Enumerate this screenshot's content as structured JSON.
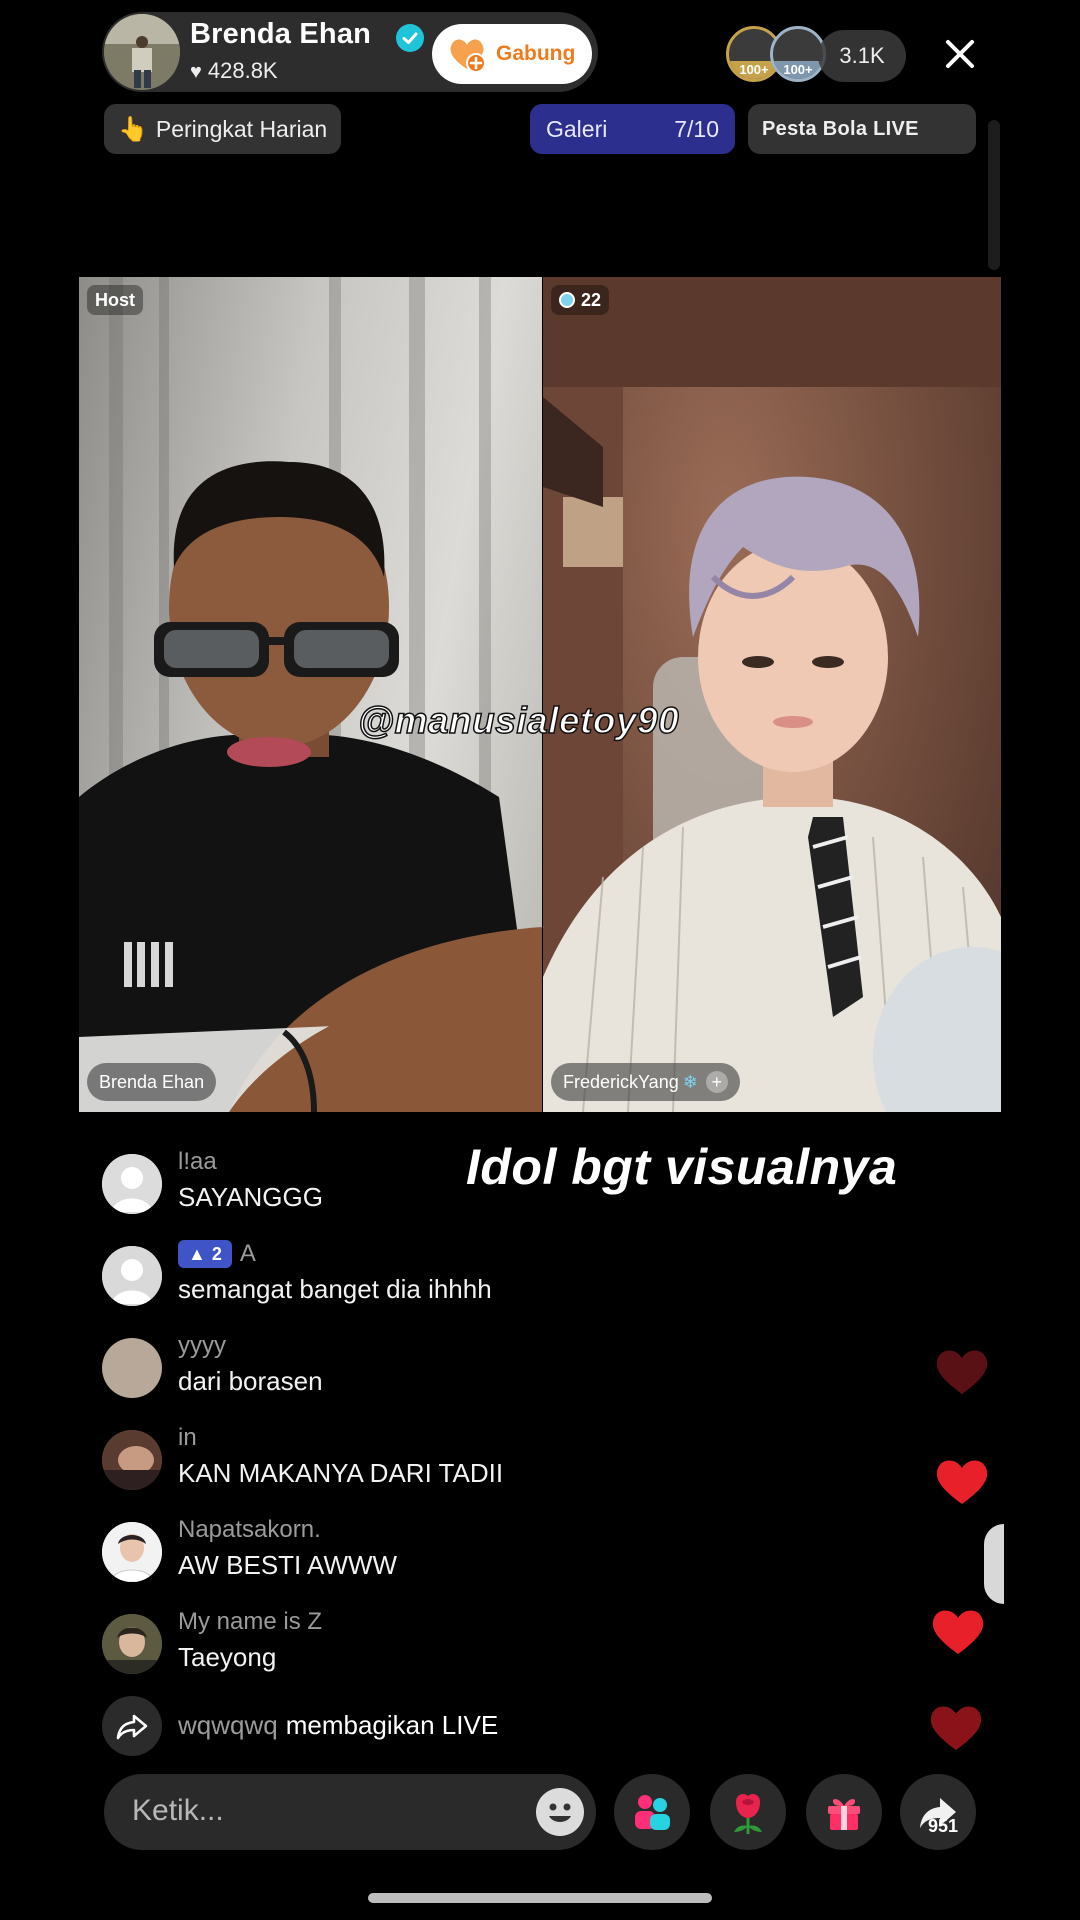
{
  "host": {
    "name": "Brenda Ehan",
    "likes": "428.8K",
    "join_label": "Gabung"
  },
  "viewers": {
    "badge1": "100+",
    "badge2": "100+",
    "count": "3.1K"
  },
  "pills": {
    "rank_label": "Peringkat Harian",
    "gallery_label": "Galeri",
    "gallery_progress": "7/10",
    "party_label": "Pesta Bola LIVE"
  },
  "panels": {
    "left_tag": "Host",
    "left_name": "Brenda Ehan",
    "right_score": "22",
    "right_name": "FrederickYang",
    "watermark": "@manusialetoy90"
  },
  "overlay_caption": "Idol bgt visualnya",
  "comments": [
    {
      "user": "l!aa",
      "text": "SAYANGGG"
    },
    {
      "user": "A",
      "level": "2",
      "text": "semangat banget dia ihhhh"
    },
    {
      "user": "yyyy",
      "text": "dari borasen"
    },
    {
      "user": "in",
      "text": "KAN MAKANYA DARI TADII"
    },
    {
      "user": "Napatsakorn.",
      "text": "AW BESTI AWWW"
    },
    {
      "user": "My name is Z",
      "text": "Taeyong"
    }
  ],
  "share_event": {
    "user": "wqwqwq",
    "text": "membagikan LIVE"
  },
  "bottom": {
    "input_placeholder": "Ketik...",
    "share_count": "951"
  },
  "colors": {
    "accent_orange": "#f07b1e",
    "gallery_blue": "#2c2f8e",
    "heart_red": "#e8202a",
    "verified_cyan": "#20c4d8"
  }
}
